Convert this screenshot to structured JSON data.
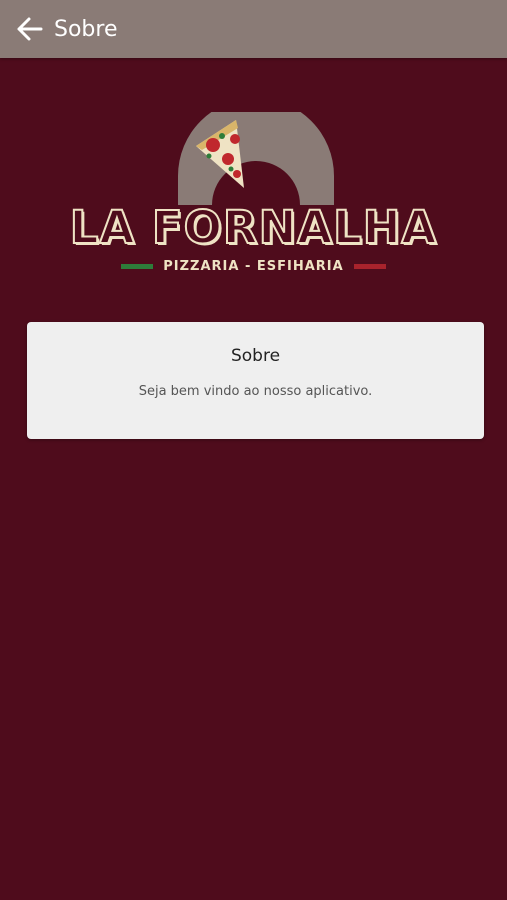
{
  "app_bar": {
    "back_icon": "arrow-left-icon",
    "title": "Sobre",
    "color": "#8a7b76"
  },
  "logo": {
    "brand_name": "LA FORNALHA",
    "tagline": "PIZZARIA - ESFIHARIA",
    "stripe_left_color": "#2e7d3a",
    "stripe_right_color": "#a8232c",
    "icon": "pizza-oven-icon"
  },
  "card": {
    "title": "Sobre",
    "body": "Seja bem vindo ao nosso aplicativo."
  },
  "theme": {
    "background": "#4f0c1c",
    "card_background": "#efefef"
  }
}
